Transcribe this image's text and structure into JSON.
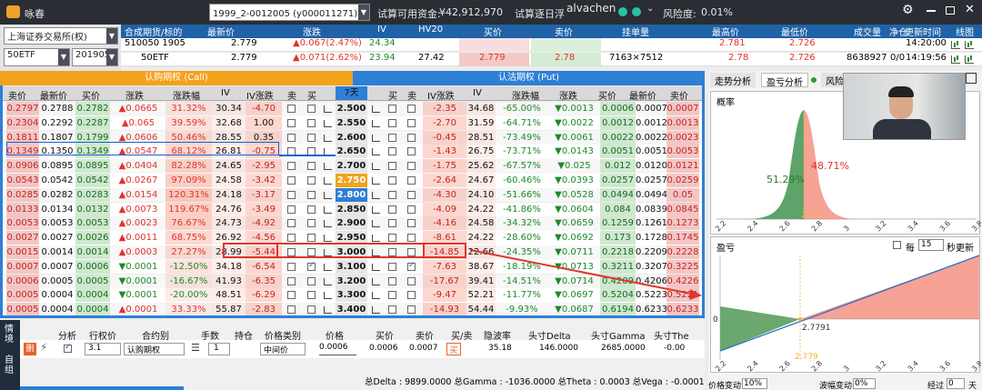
{
  "titlebar": {
    "app_name": "咏春",
    "account": "1999_2-0012005 (y000011271) (期/权)",
    "funds_label": "试算可用资金:",
    "funds_value": "¥42,912,970",
    "trial_label": "试算逐日浮",
    "user": "alvachen",
    "risk_label": "风险度:",
    "risk_value": "0.01%"
  },
  "left_panel": {
    "exchange": "上海证券交易所(权)",
    "underlying": "50ETF",
    "expiry": "201905"
  },
  "quote_header": [
    "合成期货/标的",
    "最新价",
    "涨跌",
    "IV",
    "HV20",
    "买价",
    "卖价",
    "挂单量",
    "最高价",
    "最低价",
    "成交量",
    "净仓",
    "更新时间",
    "线图"
  ],
  "quote_rows": [
    {
      "name": "510050 1905",
      "last": "2.779",
      "chg": "▲0.067(2.47%)",
      "iv": "24.34",
      "hv": "",
      "bid": "",
      "ask": "",
      "vol_q": "",
      "high": "2.781",
      "low": "2.726",
      "volume": "",
      "net": "",
      "time": "14:20:00"
    },
    {
      "name": "50ETF",
      "last": "2.779",
      "chg": "▲0.071(2.62%)",
      "iv": "23.94",
      "hv": "27.42",
      "bid": "2.779",
      "ask": "2.78",
      "vol_q": "7163×7512",
      "high": "2.78",
      "low": "2.726",
      "volume": "8638927",
      "net": "0/0",
      "time": "14:19:56"
    }
  ],
  "tbar": {
    "call_label": "认购期权 (Call)",
    "put_label": "认沽期权 (Put)"
  },
  "columns": {
    "call": [
      "卖价",
      "最新价",
      "买价",
      "涨跌",
      "涨跌幅",
      "IV",
      "IV涨跌",
      "卖",
      "买"
    ],
    "days": "7天",
    "put": [
      "买",
      "卖",
      "IV涨跌",
      "IV",
      "涨跌幅",
      "涨跌",
      "买价",
      "最新价",
      "卖价"
    ]
  },
  "rows": [
    {
      "strike": "2.500",
      "c": [
        "0.2797",
        "0.2788",
        "0.2782",
        "▲0.0665",
        "31.32%",
        "30.34",
        "-4.70"
      ],
      "p": [
        "-2.35",
        "34.68",
        "-65.00%",
        "▼0.0013",
        "0.0006",
        "0.0007",
        "0.0007"
      ]
    },
    {
      "strike": "2.550",
      "c": [
        "0.2304",
        "0.2292",
        "0.2287",
        "▲0.065",
        "39.59%",
        "32.68",
        "1.00"
      ],
      "p": [
        "-2.70",
        "31.59",
        "-64.71%",
        "▼0.0022",
        "0.0012",
        "0.0012",
        "0.0013"
      ]
    },
    {
      "strike": "2.600",
      "c": [
        "0.1811",
        "0.1807",
        "0.1799",
        "▲0.0606",
        "50.46%",
        "28.55",
        "0.35"
      ],
      "p": [
        "-0.45",
        "28.51",
        "-73.49%",
        "▼0.0061",
        "0.0022",
        "0.0022",
        "0.0023"
      ]
    },
    {
      "strike": "2.650",
      "c": [
        "0.1349",
        "0.1350",
        "0.1349",
        "▲0.0547",
        "68.12%",
        "26.81",
        "-0.75"
      ],
      "p": [
        "-1.43",
        "26.75",
        "-73.71%",
        "▼0.0143",
        "0.0051",
        "0.0051",
        "0.0053"
      ]
    },
    {
      "strike": "2.700",
      "c": [
        "0.0906",
        "0.0895",
        "0.0895",
        "▲0.0404",
        "82.28%",
        "24.65",
        "-2.95"
      ],
      "p": [
        "-1.75",
        "25.62",
        "-67.57%",
        "▼0.025",
        "0.012",
        "0.0120",
        "0.0121"
      ]
    },
    {
      "strike": "2.750",
      "c": [
        "0.0543",
        "0.0542",
        "0.0542",
        "▲0.0267",
        "97.09%",
        "24.58",
        "-3.42"
      ],
      "p": [
        "-2.64",
        "24.67",
        "-60.46%",
        "▼0.0393",
        "0.0257",
        "0.0257",
        "0.0259"
      ]
    },
    {
      "strike": "2.800",
      "c": [
        "0.0285",
        "0.0282",
        "0.0283",
        "▲0.0154",
        "120.31%",
        "24.18",
        "-3.17"
      ],
      "p": [
        "-4.30",
        "24.10",
        "-51.66%",
        "▼0.0528",
        "0.0494",
        "0.0494",
        "0.05"
      ]
    },
    {
      "strike": "2.850",
      "c": [
        "0.0133",
        "0.0134",
        "0.0132",
        "▲0.0073",
        "119.67%",
        "24.76",
        "-3.49"
      ],
      "p": [
        "-4.09",
        "24.22",
        "-41.86%",
        "▼0.0604",
        "0.084",
        "0.0839",
        "0.0845"
      ]
    },
    {
      "strike": "2.900",
      "c": [
        "0.0053",
        "0.0053",
        "0.0053",
        "▲0.0023",
        "76.67%",
        "24.73",
        "-4.92"
      ],
      "p": [
        "-4.16",
        "24.58",
        "-34.32%",
        "▼0.0659",
        "0.1259",
        "0.1261",
        "0.1273"
      ]
    },
    {
      "strike": "2.950",
      "c": [
        "0.0027",
        "0.0027",
        "0.0026",
        "▲0.0011",
        "68.75%",
        "26.92",
        "-4.56"
      ],
      "p": [
        "-8.61",
        "24.22",
        "-28.60%",
        "▼0.0692",
        "0.173",
        "0.1728",
        "0.1745"
      ]
    },
    {
      "strike": "3.000",
      "c": [
        "0.0015",
        "0.0014",
        "0.0014",
        "▲0.0003",
        "27.27%",
        "28.99",
        "-5.44"
      ],
      "p": [
        "-14.85",
        "22.66",
        "-24.35%",
        "▼0.0711",
        "0.2218",
        "0.2209",
        "0.2228"
      ]
    },
    {
      "strike": "3.100",
      "c": [
        "0.0007",
        "0.0007",
        "0.0006",
        "▼0.0001",
        "-12.50%",
        "34.18",
        "-6.54"
      ],
      "p": [
        "-7.63",
        "38.67",
        "-18.19%",
        "▼0.0713",
        "0.3211",
        "0.3207",
        "0.3225"
      ]
    },
    {
      "strike": "3.200",
      "c": [
        "0.0006",
        "0.0005",
        "0.0005",
        "▼0.0001",
        "-16.67%",
        "41.93",
        "-6.35"
      ],
      "p": [
        "-17.67",
        "39.41",
        "-14.51%",
        "▼0.0714",
        "0.4209",
        "0.4206",
        "0.4226"
      ]
    },
    {
      "strike": "3.300",
      "c": [
        "0.0005",
        "0.0004",
        "0.0004",
        "▼0.0001",
        "-20.00%",
        "48.51",
        "-6.29"
      ],
      "p": [
        "-9.47",
        "52.21",
        "-11.77%",
        "▼0.0697",
        "0.5204",
        "0.5223",
        "0.5221"
      ]
    },
    {
      "strike": "3.400",
      "c": [
        "0.0005",
        "0.0004",
        "0.0004",
        "▲0.0001",
        "33.33%",
        "55.87",
        "-2.83"
      ],
      "p": [
        "-14.93",
        "54.44",
        "-9.93%",
        "▼0.0687",
        "0.6194",
        "0.6233",
        "0.6233"
      ]
    }
  ],
  "right_panel": {
    "tabs": [
      "走势分析",
      "盈亏分析",
      "风险"
    ],
    "prob_title": "概率",
    "prob_left": "51.29%",
    "prob_right": "48.71%",
    "prob_mark": "2.78",
    "pl_title": "盈亏",
    "per_label": "每",
    "per_value": "15",
    "refresh_label": "秒更新",
    "breakeven": "2.7791",
    "pl_mark": "2.779",
    "zero": "0",
    "x_ticks": [
      "2.2",
      "2.4",
      "2.6",
      "2.8",
      "3",
      "3.2",
      "3.4",
      "3.6",
      "3.8"
    ],
    "price_change_label": "价格变动",
    "price_change": "10%",
    "vol_change_label": "波幅变动",
    "vol_change": "0%",
    "elapsed_label": "经过",
    "elapsed_value": "0",
    "day_unit": "天"
  },
  "bottom": {
    "side_tabs": [
      "情境",
      "自组"
    ],
    "headers": [
      "分析",
      "行权价",
      "合约别",
      "手数",
      "持仓",
      "价格类别",
      "价格",
      "买价",
      "卖价",
      "买/卖",
      "隐波率",
      "头寸Delta",
      "头寸Gamma",
      "头寸The"
    ],
    "strike": "3.1",
    "contract": "认购期权",
    "qty": "1",
    "price_type": "中间价",
    "price": "0.0006",
    "bid": "0.0006",
    "ask": "0.0007",
    "side": "买",
    "iv": "35.18",
    "delta": "146.0000",
    "gamma": "2685.0000",
    "theta": "-0.00",
    "totals": "总Delta : 9899.0000 总Gamma : -1036.0000 总Theta : 0.0003   总Vega : -0.0001"
  }
}
